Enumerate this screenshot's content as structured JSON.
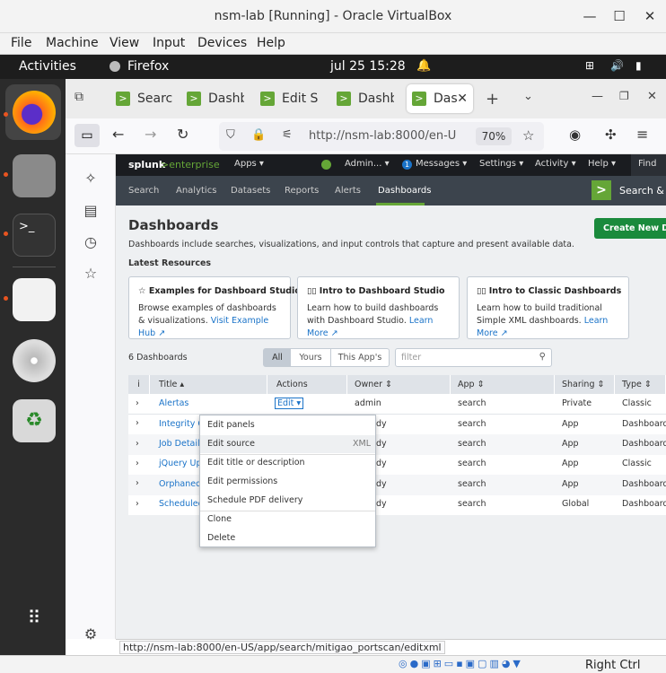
{
  "vbox": {
    "title": "nsm-lab [Running] - Oracle VirtualBox",
    "menu": [
      "File",
      "Machine",
      "View",
      "Input",
      "Devices",
      "Help"
    ],
    "host_key": "Right Ctrl"
  },
  "gnome": {
    "activities": "Activities",
    "app": "Firefox",
    "clock": "jul 25  15:28"
  },
  "firefox": {
    "tabs": [
      "Search",
      "Dashb",
      "Edit S",
      "Dashb",
      "Das"
    ],
    "url": "http://nsm-lab:8000/en-U",
    "zoom": "70%",
    "status_url": "http://nsm-lab:8000/en-US/app/search/mitigao_portscan/editxml"
  },
  "splunk": {
    "logo_a": "splunk",
    "logo_b": ">enterprise",
    "top": {
      "apps": "Apps ▾",
      "admin": "Admin... ▾",
      "messages_count": "1",
      "messages": "Messages ▾",
      "settings": "Settings ▾",
      "activity": "Activity ▾",
      "help": "Help ▾",
      "find": "Find"
    },
    "nav": [
      "Search",
      "Analytics",
      "Datasets",
      "Reports",
      "Alerts",
      "Dashboards"
    ],
    "search_app": "Search & R",
    "page_title": "Dashboards",
    "page_desc": "Dashboards include searches, visualizations, and input controls that capture and present available data.",
    "create_btn": "Create New Das",
    "latest": "Latest Resources",
    "cards": [
      {
        "title": "Examples for Dashboard Studio",
        "body": "Browse examples of dashboards & visualizations. ",
        "link": "Visit Example Hub"
      },
      {
        "title": "Intro to Dashboard Studio",
        "body": "Learn how to build dashboards with Dashboard Studio. ",
        "link": "Learn More"
      },
      {
        "title": "Intro to Classic Dashboards",
        "body": "Learn how to build traditional Simple XML dashboards. ",
        "link": "Learn More"
      }
    ],
    "count": "6 Dashboards",
    "filters": [
      "All",
      "Yours",
      "This App's"
    ],
    "filter_placeholder": "filter",
    "columns": [
      "i",
      "Title",
      "Actions",
      "Owner",
      "App",
      "Sharing",
      "Type"
    ],
    "rows": [
      {
        "title": "Alertas",
        "action": "Edit ▾",
        "owner": "admin",
        "app": "search",
        "sharing": "Private",
        "type": "Classic"
      },
      {
        "title": "Integrity Cl",
        "owner": "dy",
        "app": "search",
        "sharing": "App",
        "type": "Dashboard"
      },
      {
        "title": "Job Details",
        "owner": "dy",
        "app": "search",
        "sharing": "App",
        "type": "Dashboard"
      },
      {
        "title": "jQuery Upd",
        "owner": "dy",
        "app": "search",
        "sharing": "App",
        "type": "Classic"
      },
      {
        "title": "Orphaned",
        "owner": "dy",
        "app": "search",
        "sharing": "App",
        "type": "Dashboard"
      },
      {
        "title": "Scheduled",
        "owner": "dy",
        "app": "search",
        "sharing": "Global",
        "type": "Dashboard"
      }
    ],
    "menu": [
      "Edit panels",
      "Edit source",
      "XML",
      "Edit title or description",
      "Edit permissions",
      "Schedule PDF delivery",
      "Clone",
      "Delete"
    ]
  },
  "colors": {
    "splunk_green": "#65a637",
    "accent_blue": "#1a73c8",
    "ubuntu_orange": "#e95420"
  }
}
